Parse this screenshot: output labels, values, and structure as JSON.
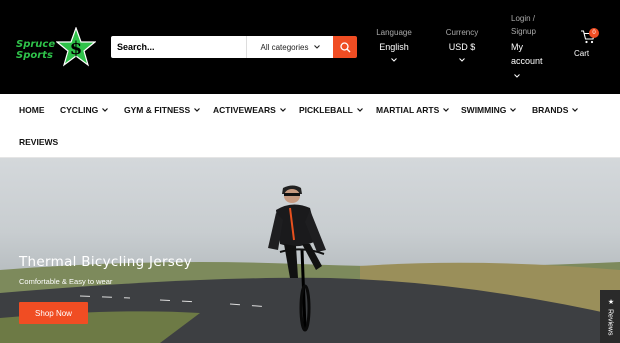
{
  "brand": {
    "logo_line1": "Spruce",
    "logo_line2": "Sports",
    "logo_symbol": "$"
  },
  "search": {
    "placeholder": "Search...",
    "category": "All categories"
  },
  "header": {
    "language_label": "Language",
    "language_value": "English",
    "currency_label": "Currency",
    "currency_value": "USD $",
    "login_line1": "Login /",
    "login_line2": "Signup",
    "account_line1": "My",
    "account_line2": "account",
    "cart_count": "0",
    "cart_label": "Cart"
  },
  "nav": {
    "items": [
      {
        "label": "HOME",
        "dropdown": false
      },
      {
        "label": "CYCLING",
        "dropdown": true
      },
      {
        "label": "GYM & FITNESS",
        "dropdown": true
      },
      {
        "label": "ACTIVEWEARS",
        "dropdown": true
      },
      {
        "label": "PICKLEBALL",
        "dropdown": true
      },
      {
        "label": "MARTIAL ARTS",
        "dropdown": true
      },
      {
        "label": "SWIMMING",
        "dropdown": true
      },
      {
        "label": "BRANDS",
        "dropdown": true
      },
      {
        "label": "REVIEWS",
        "dropdown": false
      }
    ]
  },
  "hero": {
    "title": "Thermal Bicycling Jersey",
    "subtitle": "Comfortable & Easy to wear",
    "button": "Shop Now"
  },
  "reviews_tab": {
    "star": "★",
    "label": "Reviews"
  },
  "colors": {
    "accent": "#f04d23",
    "logo_green": "#2fc24a",
    "header_bg": "#000000"
  }
}
